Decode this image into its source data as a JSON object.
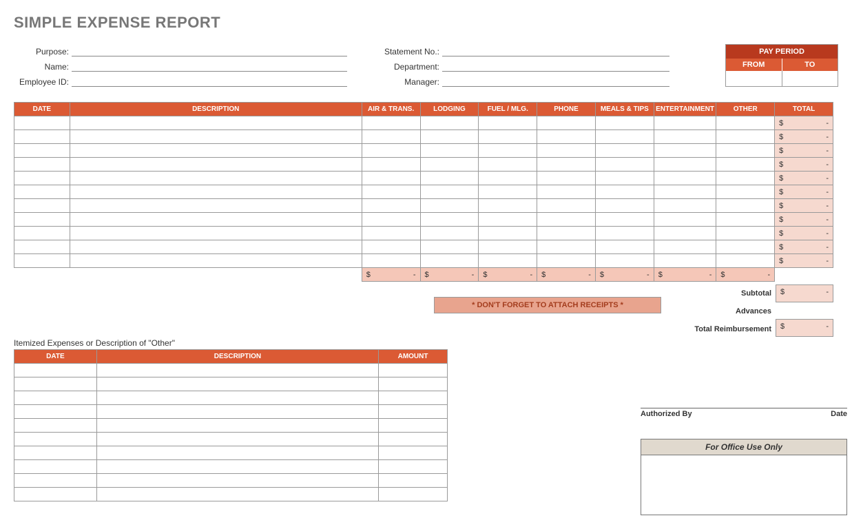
{
  "title": "SIMPLE EXPENSE REPORT",
  "info_left": {
    "purpose": "Purpose:",
    "name": "Name:",
    "employee_id": "Employee ID:"
  },
  "info_mid": {
    "statement_no": "Statement No.:",
    "department": "Department:",
    "manager": "Manager:"
  },
  "pay_period": {
    "title": "PAY PERIOD",
    "from": "FROM",
    "to": "TO"
  },
  "main_headers": {
    "date": "DATE",
    "description": "DESCRIPTION",
    "air": "AIR & TRANS.",
    "lodging": "LODGING",
    "fuel": "FUEL / MLG.",
    "phone": "PHONE",
    "meals": "MEALS & TIPS",
    "entertainment": "ENTERTAINMENT",
    "other": "OTHER",
    "total": "TOTAL"
  },
  "currency": "$",
  "dash": "-",
  "receipts_note": "* DON'T FORGET TO ATTACH RECEIPTS *",
  "summary": {
    "subtotal": "Subtotal",
    "advances": "Advances",
    "total_reimb": "Total Reimbursement"
  },
  "itemized_title": "Itemized Expenses or Description of \"Other\"",
  "itemized_headers": {
    "date": "DATE",
    "description": "DESCRIPTION",
    "amount": "AMOUNT"
  },
  "signature": {
    "authorized_by": "Authorized By",
    "date": "Date"
  },
  "office_use": "For Office Use Only"
}
